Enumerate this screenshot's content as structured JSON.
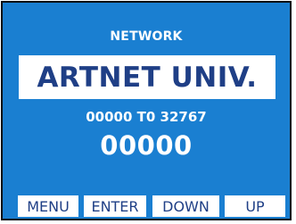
{
  "screen": {
    "menu_title": "NETWORK",
    "parameter": "ARTNET UNIV.",
    "range": "00000 T0 32767",
    "value": "00000"
  },
  "soft_keys": {
    "menu": "MENU",
    "enter": "ENTER",
    "down": "DOWN",
    "up": "UP"
  },
  "colors": {
    "screen_background": "#1a7fd1",
    "text_on_screen": "#ffffff",
    "highlight_background": "#ffffff",
    "highlight_text": "#1f3f86"
  }
}
